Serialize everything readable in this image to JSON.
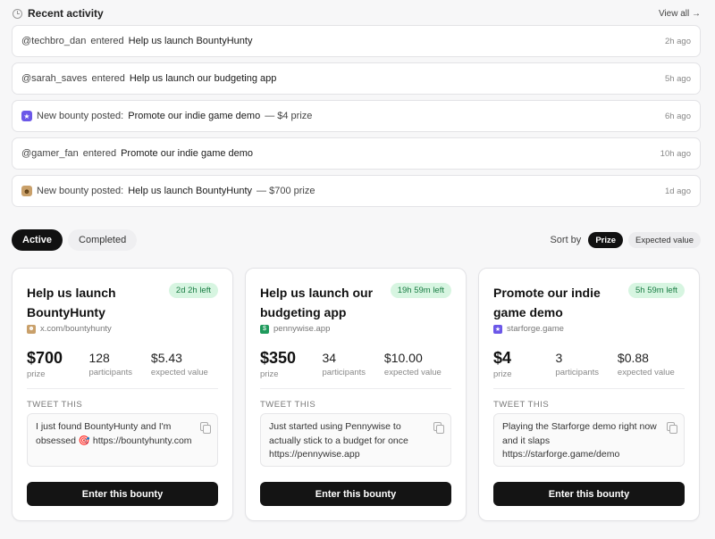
{
  "recent_activity": {
    "title": "Recent activity",
    "view_all": "View all →",
    "items": [
      {
        "user": "@techbro_dan",
        "action": "entered",
        "target": "Help us launch BountyHunty",
        "time": "2h ago",
        "icon": ""
      },
      {
        "user": "@sarah_saves",
        "action": "entered",
        "target": "Help us launch our budgeting app",
        "time": "5h ago",
        "icon": ""
      },
      {
        "prefix": "New bounty posted:",
        "target": "Promote our indie game demo",
        "suffix": "— $4 prize",
        "time": "6h ago",
        "icon": "star-icon"
      },
      {
        "user": "@gamer_fan",
        "action": "entered",
        "target": "Promote our indie game demo",
        "time": "10h ago",
        "icon": ""
      },
      {
        "prefix": "New bounty posted:",
        "target": "Help us launch BountyHunty",
        "suffix": "— $700 prize",
        "time": "1d ago",
        "icon": "bounty-hunter-icon"
      }
    ]
  },
  "tabs": {
    "active": "Active",
    "completed": "Completed"
  },
  "sort": {
    "label": "Sort by",
    "prize": "Prize",
    "expected_value": "Expected value"
  },
  "cards": [
    {
      "title": "Help us launch BountyHunty",
      "time_left": "2d 2h left",
      "site": "x.com/bountyhunty",
      "prize": "$700",
      "prize_label": "prize",
      "participants": "128",
      "participants_label": "participants",
      "expected_value": "$5.43",
      "expected_value_label": "expected value",
      "tweet_label": "TWEET THIS",
      "tweet": "I just found BountyHunty and I'm obsessed 🎯 https://bountyhunty.com",
      "button": "Enter this bounty"
    },
    {
      "title": "Help us launch our budgeting app",
      "time_left": "19h 59m left",
      "site": "pennywise.app",
      "prize": "$350",
      "prize_label": "prize",
      "participants": "34",
      "participants_label": "participants",
      "expected_value": "$10.00",
      "expected_value_label": "expected value",
      "tweet_label": "TWEET THIS",
      "tweet": "Just started using Pennywise to actually stick to a budget for once https://pennywise.app",
      "button": "Enter this bounty"
    },
    {
      "title": "Promote our indie game demo",
      "time_left": "5h 59m left",
      "site": "starforge.game",
      "prize": "$4",
      "prize_label": "prize",
      "participants": "3",
      "participants_label": "participants",
      "expected_value": "$0.88",
      "expected_value_label": "expected value",
      "tweet_label": "TWEET THIS",
      "tweet": "Playing the Starforge demo right now and it slaps https://starforge.game/demo",
      "button": "Enter this bounty"
    }
  ],
  "colors": {
    "accent": "#111111",
    "badge_bg": "#d7f5e1",
    "badge_text": "#1b7d45",
    "star": "#6b57e8"
  }
}
